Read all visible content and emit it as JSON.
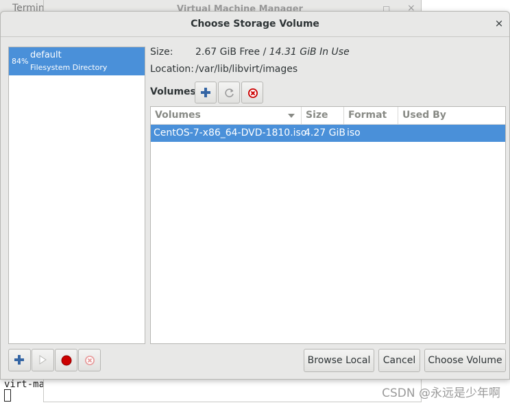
{
  "background": {
    "terminal_tab_label": "Termin",
    "vmm_title": "Virtual Machine Manager",
    "vmm_max_glyph": "□",
    "vmm_close_glyph": "×",
    "terminal_text": "virt-ma",
    "watermark": "CSDN @永远是少年啊"
  },
  "dialog": {
    "title": "Choose Storage Volume",
    "close_glyph": "×"
  },
  "pools": [
    {
      "percent": "84%",
      "name": "default",
      "type": "Filesystem Directory",
      "selected": true
    }
  ],
  "pool_info": {
    "size_label": "Size:",
    "size_free": "2.67 GiB Free / ",
    "size_in_use": "14.31 GiB In Use",
    "location_label": "Location:",
    "location_value": "/var/lib/libvirt/images"
  },
  "volumes_heading": "Volumes",
  "volume_toolbar": {
    "add_icon": "plus-icon",
    "refresh_icon": "refresh-icon",
    "delete_icon": "delete-icon"
  },
  "volume_table": {
    "columns": [
      "Volumes",
      "Size",
      "Format",
      "Used By"
    ],
    "rows": [
      {
        "name": "CentOS-7-x86_64-DVD-1810.iso",
        "size": "4.27 GiB",
        "format": "iso",
        "used_by": ""
      }
    ]
  },
  "pool_toolbar": {
    "add_icon": "plus-icon",
    "start_icon": "play-icon",
    "stop_icon": "stop-icon",
    "delete_icon": "delete-icon"
  },
  "buttons": {
    "browse_local": "Browse Local",
    "cancel": "Cancel",
    "choose_volume": "Choose Volume"
  },
  "colors": {
    "selection": "#4a90d9",
    "dialog_bg": "#e8e8e7",
    "add_blue": "#3465a4",
    "delete_red": "#cc0000"
  }
}
